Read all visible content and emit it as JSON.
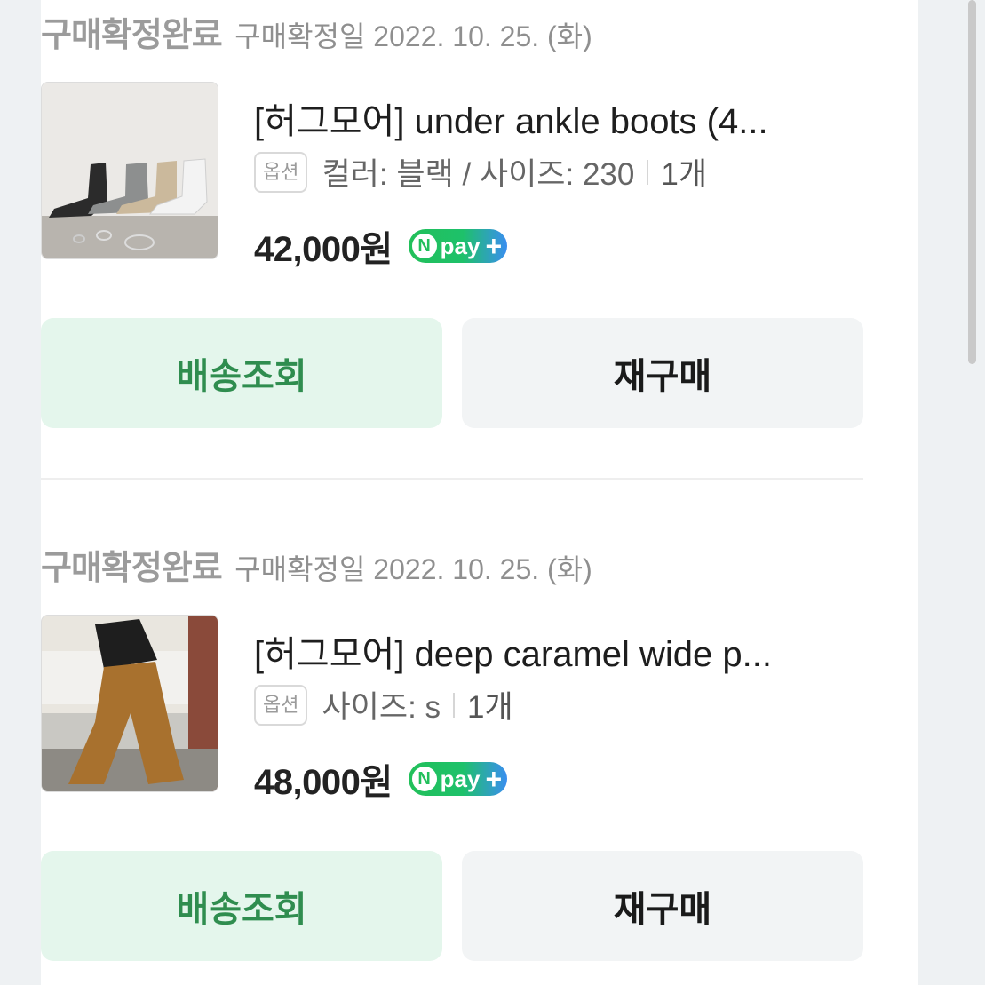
{
  "orders": [
    {
      "status": "구매확정완료",
      "confirm_date": "구매확정일 2022. 10. 25. (화)",
      "title": "[허그모어] under ankle boots (4...",
      "option_badge": "옵션",
      "option_text": "컬러: 블랙 / 사이즈: 230",
      "quantity": "1개",
      "price": "42,000원",
      "pay_badge": "pay",
      "track_label": "배송조회",
      "rebuy_label": "재구매"
    },
    {
      "status": "구매확정완료",
      "confirm_date": "구매확정일 2022. 10. 25. (화)",
      "title": "[허그모어] deep caramel wide p...",
      "option_badge": "옵션",
      "option_text": "사이즈: s",
      "quantity": "1개",
      "price": "48,000원",
      "pay_badge": "pay",
      "track_label": "배송조회",
      "rebuy_label": "재구매"
    }
  ],
  "colors": {
    "track_bg": "#e4f6ec",
    "track_text": "#2f8d4f",
    "rebuy_bg": "#f2f4f5",
    "npay_green": "#22c05a",
    "npay_blue": "#3a8ef0"
  }
}
